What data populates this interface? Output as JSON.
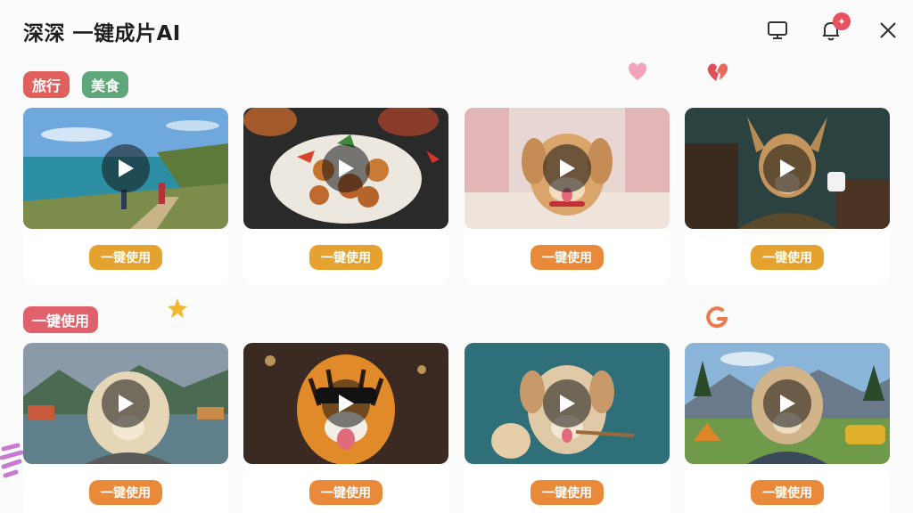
{
  "header": {
    "title": "深深 一键成片AI",
    "notification_badge": "✦",
    "icons": [
      "monitor-icon",
      "bell-icon",
      "close-icon"
    ]
  },
  "section1": {
    "tags": [
      {
        "label": "旅行",
        "color": "#e0605c"
      },
      {
        "label": "美食",
        "color": "#5ea77a"
      }
    ],
    "cards": [
      {
        "subject": "coastal-hike",
        "button": "一键使用",
        "button_color": "#e6a22e"
      },
      {
        "subject": "food-plate",
        "button": "一键使用",
        "button_color": "#e6a22e"
      },
      {
        "subject": "puppy-sofa",
        "button": "一键使用",
        "button_color": "#e98a3a"
      },
      {
        "subject": "dog-coffee",
        "button": "一键使用",
        "button_color": "#e6a22e"
      }
    ]
  },
  "section2": {
    "tags": [
      {
        "label": "一键使用",
        "color": "#e0606c"
      }
    ],
    "cards": [
      {
        "subject": "dog-lake-town",
        "button": "一键使用",
        "button_color": "#e98a3a"
      },
      {
        "subject": "tiger-sunglasses",
        "button": "一键使用",
        "button_color": "#e98a3a"
      },
      {
        "subject": "puppy-paintbrush",
        "button": "一键使用",
        "button_color": "#e98a3a"
      },
      {
        "subject": "dog-mountain-camp",
        "button": "一键使用",
        "button_color": "#e98a3a"
      }
    ]
  }
}
